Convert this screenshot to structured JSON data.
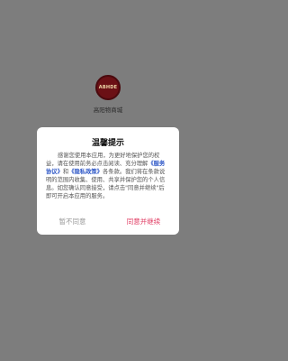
{
  "app": {
    "logo_text": "ABHDE",
    "name": "高阳物商城"
  },
  "dialog": {
    "title": "温馨提示",
    "body_part1": "感谢您使用本应用，为更好地保护您的权益，请在使用前务必点击阅读、充分理解",
    "link_service": "《服务协议》",
    "body_and": "和",
    "link_privacy": "《隐私政策》",
    "body_part2": "各条款。我们将在条款说明的范围内收集、使用、共享并保护您的个人信息。如您确认同意接受，请点击\"同意并继续\"后即可开启本应用的服务。",
    "disagree_label": "暂不同意",
    "agree_label": "同意并继续"
  },
  "colors": {
    "overlay": "#7d7d7d",
    "link": "#2f58c7",
    "agree": "#e03b62",
    "logo_bg": "#6b1015"
  }
}
